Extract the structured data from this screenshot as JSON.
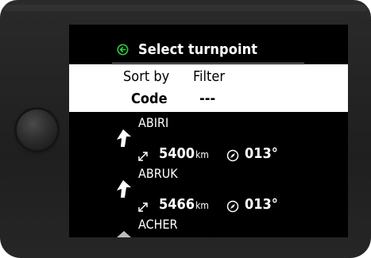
{
  "header": {
    "title": "Select turnpoint",
    "back_icon": "back-arrow-circle-icon"
  },
  "controls": {
    "sort_label": "Sort by",
    "filter_label": "Filter",
    "sort_value": "Code",
    "filter_value": "---"
  },
  "turnpoints": [
    {
      "name": "ABIRI",
      "distance": "5400",
      "distance_unit": "km",
      "bearing": "013°"
    },
    {
      "name": "ABRUK",
      "distance": "5466",
      "distance_unit": "km",
      "bearing": "013°"
    },
    {
      "name": "ACHER",
      "distance": "",
      "distance_unit": "",
      "bearing": ""
    }
  ],
  "colors": {
    "accent": "#2ecc40",
    "screen_bg": "#000000",
    "panel_bg": "#ffffff",
    "text_light": "#ffffff"
  },
  "icons": {
    "direction": "direction-arrow-icon",
    "distance": "diagonal-double-arrow-icon",
    "bearing": "compass-icon"
  }
}
